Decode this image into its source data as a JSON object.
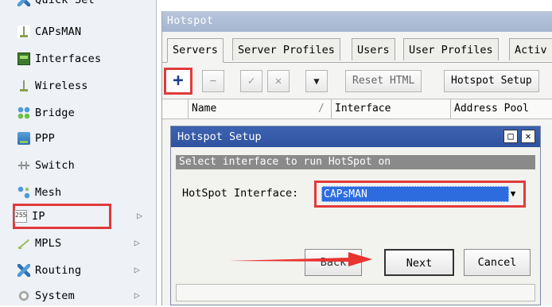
{
  "sidebar": {
    "items": [
      {
        "label": "Quick Set",
        "icon": "quick-set-icon"
      },
      {
        "label": "CAPsMAN",
        "icon": "capsman-icon"
      },
      {
        "label": "Interfaces",
        "icon": "interfaces-icon"
      },
      {
        "label": "Wireless",
        "icon": "wireless-icon"
      },
      {
        "label": "Bridge",
        "icon": "bridge-icon"
      },
      {
        "label": "PPP",
        "icon": "ppp-icon"
      },
      {
        "label": "Switch",
        "icon": "switch-icon"
      },
      {
        "label": "Mesh",
        "icon": "mesh-icon"
      },
      {
        "label": "IP",
        "icon": "ip-icon",
        "icon_text": "255"
      },
      {
        "label": "MPLS",
        "icon": "mpls-icon"
      },
      {
        "label": "Routing",
        "icon": "routing-icon"
      },
      {
        "label": "System",
        "icon": "system-icon"
      }
    ],
    "submenu_arrow": "▷"
  },
  "hotspot": {
    "title": "Hotspot",
    "tabs": [
      "Servers",
      "Server Profiles",
      "Users",
      "User Profiles",
      "Activ"
    ],
    "toolbar": {
      "add": "+",
      "remove": "−",
      "enable": "✓",
      "disable": "✕",
      "filter": "▼",
      "reset_html": "Reset HTML",
      "hotspot_setup": "Hotspot Setup"
    },
    "columns": [
      "Name",
      "Interface",
      "Address Pool"
    ],
    "sort_marker": "/"
  },
  "dialog": {
    "title": "Hotspot Setup",
    "subtitle": "Select interface to run HotSpot on",
    "field_label": "HotSpot Interface:",
    "field_value": "CAPsMAN",
    "back_label": "Back",
    "next_label": "Next",
    "cancel_label": "Cancel",
    "maximize": "□",
    "close": "✕"
  },
  "colors": {
    "highlight_red": "#e03b3b",
    "selection_blue": "#2d6cdf",
    "dialog_title_blue": "#2f52a0"
  }
}
